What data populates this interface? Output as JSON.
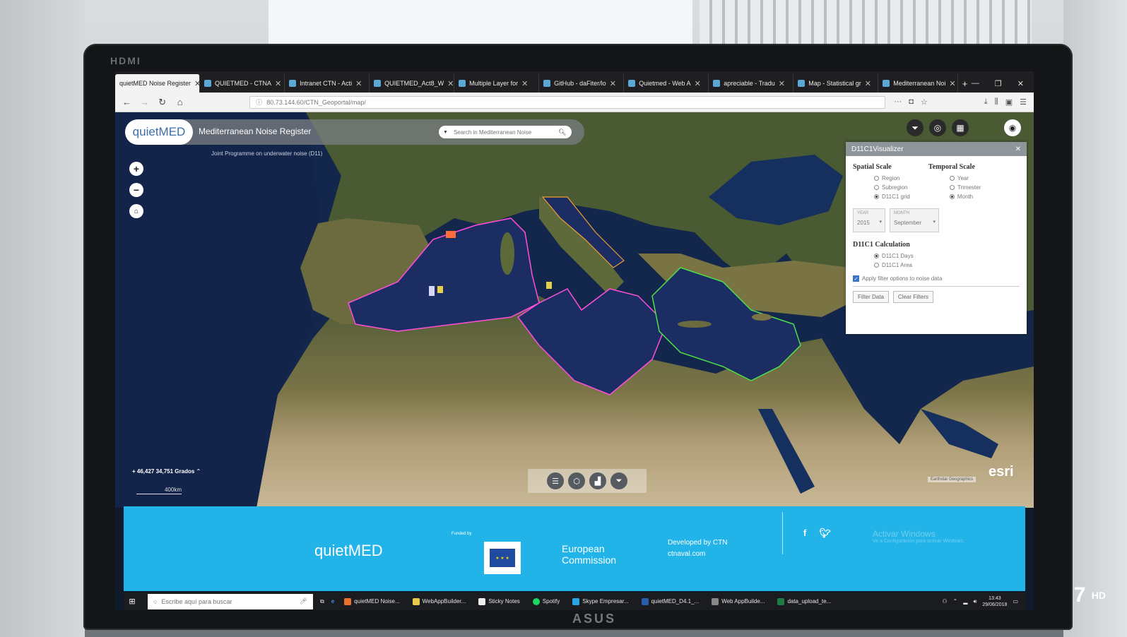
{
  "overlay": {
    "bezel_brand": "HDMI",
    "monitor_brand": "ASUS",
    "channel_logo": "7",
    "channel_hd": "HD"
  },
  "browser": {
    "tabs": [
      {
        "label": "quietMED Noise Register",
        "active": true
      },
      {
        "label": "QUIETMED - CTNA"
      },
      {
        "label": "Intranet CTN - Acti"
      },
      {
        "label": "QUIETMED_Act8_W"
      },
      {
        "label": "Multiple Layer for"
      },
      {
        "label": "GitHub - daFiter/lo"
      },
      {
        "label": "Quietmed - Web A"
      },
      {
        "label": "apreciable - Tradu"
      },
      {
        "label": "Map - Statistical gr"
      },
      {
        "label": "Mediterranean Noi"
      }
    ],
    "new_tab": "+",
    "url": "80.73.144.60/CTN_Geoportal/map/"
  },
  "app": {
    "logo": "quietMED",
    "title": "Mediterranean Noise Register",
    "subtitle": "Joint Programme on underwater noise (D11)",
    "search_placeholder": "Search in Mediterranean Noise"
  },
  "map": {
    "coords": "46,427 34,751 Grados",
    "scale": "400km",
    "esri": "esri",
    "attribution": "Earthstar Geographics"
  },
  "panel": {
    "title": "D11C1Visualizer",
    "spatial_scale": "Spatial Scale",
    "temporal_scale": "Temporal Scale",
    "spatial_options": [
      {
        "label": "Region",
        "selected": false
      },
      {
        "label": "Subregion",
        "selected": false
      },
      {
        "label": "D11C1 grid",
        "selected": true
      }
    ],
    "temporal_options": [
      {
        "label": "Year",
        "selected": false
      },
      {
        "label": "Trimester",
        "selected": false
      },
      {
        "label": "Month",
        "selected": true
      }
    ],
    "year_label": "YEAR",
    "year_value": "2015",
    "month_label": "MONTH",
    "month_value": "September",
    "calc_heading": "D11C1 Calculation",
    "calc_options": [
      {
        "label": "D11C1 Days",
        "selected": true
      },
      {
        "label": "D11C1 Area",
        "selected": false
      }
    ],
    "filter_checkbox": "Apply filter options to noise data",
    "filter_button": "Filter Data",
    "clear_button": "Clear Filters"
  },
  "footer": {
    "logo": "quietMED",
    "funded_by": "Funded by",
    "eu_line1": "European",
    "eu_line2": "Commission",
    "developed_by": "Developed by CTN",
    "developer_site": "ctnaval.com",
    "activate_title": "Activar Windows",
    "activate_sub": "Ve a Configuración para activar Windows."
  },
  "taskbar": {
    "search_placeholder": "Escribe aquí para buscar",
    "apps": [
      "quietMED Noise...",
      "WebAppBuilder...",
      "Sticky Notes",
      "Spotify",
      "Skype Empresar...",
      "quietMED_D4.1_...",
      "Web AppBuilde...",
      "data_upload_te..."
    ],
    "time": "13:43",
    "date": "29/06/2018"
  }
}
